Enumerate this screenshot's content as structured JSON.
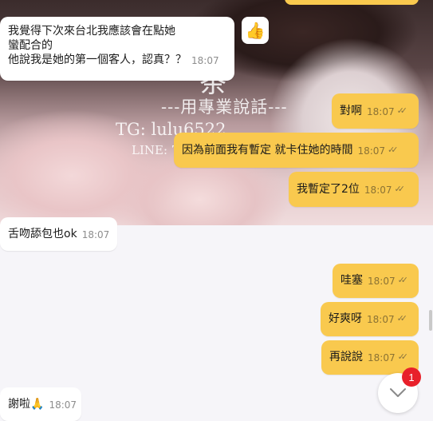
{
  "watermark": {
    "title": "茶",
    "slogan": "---用專業說話---",
    "tg": "TG: lulu6522",
    "line": "LINE: 7"
  },
  "reaction": {
    "emoji": "👍"
  },
  "messages": [
    {
      "dir": "in",
      "lines": [
        "我覺得下次來台北我應該會在點她",
        "蠻配合的",
        "他說我是她的第一個客人，認真？？"
      ],
      "time": "18:07"
    },
    {
      "dir": "out",
      "text": "對啊",
      "time": "18:07",
      "ticks": "✓✓"
    },
    {
      "dir": "out",
      "text": "因為前面我有暫定 就卡住她的時間",
      "time": "18:07",
      "ticks": "✓✓"
    },
    {
      "dir": "out",
      "text": "我暫定了2位",
      "time": "18:07",
      "ticks": "✓✓"
    },
    {
      "dir": "in",
      "text": "舌吻舔包也ok",
      "time": "18:07"
    },
    {
      "dir": "out",
      "text": "哇塞",
      "time": "18:07",
      "ticks": "✓✓"
    },
    {
      "dir": "out",
      "text": "好爽呀",
      "time": "18:07",
      "ticks": "✓✓"
    },
    {
      "dir": "out",
      "text": "再說說",
      "time": "18:07",
      "ticks": "✓✓"
    },
    {
      "dir": "in",
      "text": "謝啦🙏",
      "time": "18:07"
    }
  ],
  "scroll_down": {
    "icon": "chevron-down",
    "badge_count": "1"
  },
  "colors": {
    "outgoing": "#f9c94e",
    "incoming": "#ffffff",
    "badge": "#e8202a"
  }
}
